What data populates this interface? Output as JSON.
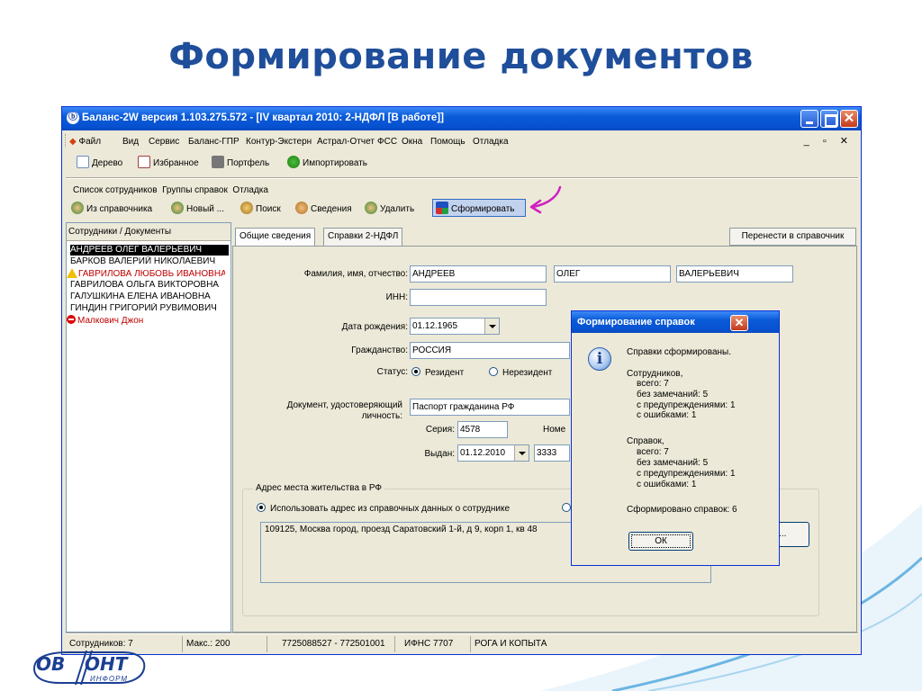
{
  "slide": {
    "title": "Формирование документов"
  },
  "window": {
    "title": "Баланс-2W  версия 1.103.275.572 - [IV квартал 2010: 2-НДФЛ [В работе]]",
    "icon": "app-icon"
  },
  "menubar": {
    "items": [
      "Файл",
      "Вид",
      "Сервис",
      "Баланс-ГПР",
      "Контур-Экстерн",
      "Астрал-Отчет",
      "ФСС",
      "Окна",
      "Помощь",
      "Отладка"
    ],
    "mdi_controls": "_ ▫ ✕"
  },
  "toolbar": {
    "items": [
      "Дерево",
      "Избранное",
      "Портфель",
      "Импортировать"
    ]
  },
  "submenu": {
    "items": [
      "Список сотрудников",
      "Группы справок",
      "Отладка"
    ]
  },
  "actions": {
    "items": [
      "Из справочника",
      "Новый ...",
      "Поиск",
      "Сведения",
      "Удалить",
      "Сформировать"
    ]
  },
  "employees": {
    "header": "Сотрудники / Документы",
    "rows": [
      {
        "name": "АНДРЕЕВ ОЛЕГ ВАЛЕРЬЕВИЧ",
        "state": "selected"
      },
      {
        "name": "БАРКОВ ВАЛЕРИЙ НИКОЛАЕВИЧ",
        "state": "normal"
      },
      {
        "name": "ГАВРИЛОВА ЛЮБОВЬ ИВАНОВНА",
        "state": "warning"
      },
      {
        "name": "ГАВРИЛОВА ОЛЬГА ВИКТОРОВНА",
        "state": "normal"
      },
      {
        "name": "ГАЛУШКИНА ЕЛЕНА ИВАНОВНА",
        "state": "normal"
      },
      {
        "name": "ГИНДИН ГРИГОРИЙ РУВИМОВИЧ",
        "state": "normal"
      },
      {
        "name": "Малкович Джон",
        "state": "error"
      }
    ]
  },
  "tabs": {
    "items": [
      "Общие сведения",
      "Справки 2-НДФЛ"
    ],
    "active": "Общие сведения",
    "transfer_button": "Перенести в справочник"
  },
  "form": {
    "fio_label": "Фамилия, имя, отчество:",
    "last_name": "АНДРЕЕВ",
    "first_name": "ОЛЕГ",
    "middle_name": "ВАЛЕРЬЕВИЧ",
    "inn_label": "ИНН:",
    "inn": "",
    "birth_label": "Дата рождения:",
    "birth_date": "01.12.1965",
    "citizenship_label": "Гражданство:",
    "citizenship": "РОССИЯ",
    "status_label": "Статус:",
    "status_resident": "Резидент",
    "status_nonresident": "Нерезидент",
    "doc_label_1": "Документ, удостоверяющий",
    "doc_label_2": "личность:",
    "doc_type": "Паспорт гражданина РФ",
    "series_label": "Серия:",
    "series": "4578",
    "number_label": "Номе",
    "issued_label": "Выдан:",
    "issued_date": "01.12.2010",
    "issued_code": "3333",
    "address_group": "Адрес места жительства в РФ",
    "address_option": "Использовать адрес из справочных данных о сотруднике",
    "address": "109125, Москва город, проезд Саратовский 1-й, д 9, корп 1, кв 48",
    "edit_button": "ировать..."
  },
  "dialog": {
    "title": "Формирование справок",
    "icon": "info-icon",
    "lines": [
      "Справки сформированы.",
      "",
      "Сотрудников,",
      "   всего: 7",
      "   без замечаний: 5",
      "   с предупреждениями: 1",
      "   с ошибками: 1",
      "",
      "Справок,",
      "   всего: 7",
      "   без замечаний: 5",
      "   с предупреждениями: 1",
      "   с ошибками: 1",
      "",
      "Сформировано справок: 6"
    ],
    "ok": "ОК"
  },
  "statusbar": {
    "employees": "Сотрудников: 7",
    "max": "Макс.: 200",
    "inn_kpp": "7725088527 - 772501001",
    "ifns": "ИФНС 7707",
    "company": "РОГА И КОПЫТА"
  },
  "logo": {
    "left": "OB",
    "right": "OHT",
    "sub": "ИНФОРМ"
  },
  "colors": {
    "title": "#1f4e9a",
    "xp_blue": "#0a5bd8",
    "selection": "#000000",
    "error": "#c00000",
    "accent_arrow": "#d020c0"
  }
}
